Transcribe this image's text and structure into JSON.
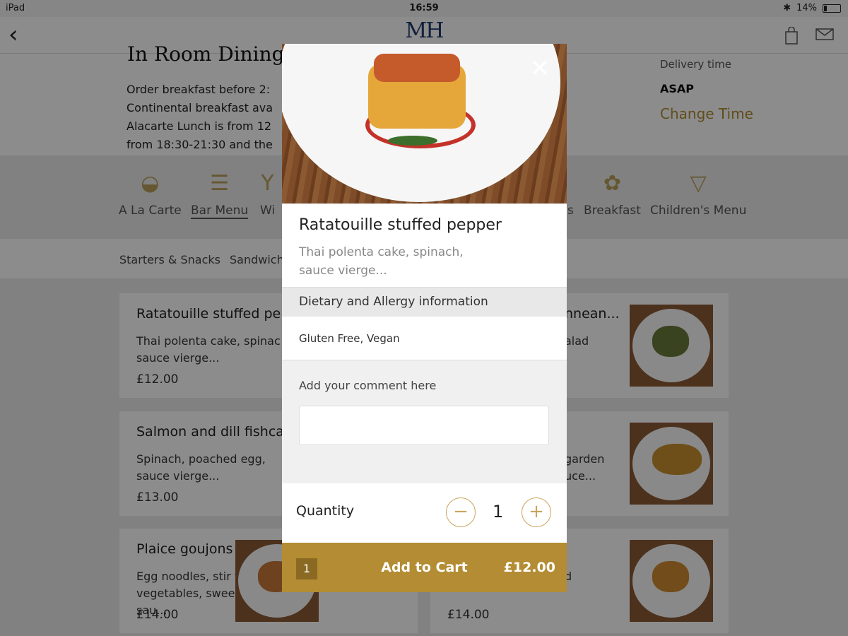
{
  "status_bar": {
    "device": "iPad",
    "time": "16:59",
    "battery": "14%"
  },
  "nav": {
    "logo": "MH"
  },
  "header": {
    "title": "In Room Dining",
    "intro": "Order breakfast before 2:\nContinental breakfast ava\nAlacarte Lunch is from 12\nfrom 18:30-21:30 and the",
    "delivery_label": "Delivery time",
    "delivery_value": "ASAP",
    "change_time": "Change Time"
  },
  "categories": [
    "A La Carte",
    "Bar Menu",
    "Wi",
    "s",
    "Breakfast",
    "Children's Menu"
  ],
  "subcategories": [
    "Starters & Snacks",
    "Sandwich"
  ],
  "menu_items": [
    {
      "name": "Ratatouille stuffed pep",
      "desc": "Thai polenta cake, spinac\nsauce vierge...",
      "price": "£12.00"
    },
    {
      "name": "Salmon and dill fishca",
      "desc": "Spinach, poached egg,\nsauce vierge...",
      "price": "£13.00"
    },
    {
      "name": "Plaice goujons",
      "desc": "Egg noodles, stir fry\nvegetables, sweet chilli sau...",
      "price": "£14.00"
    },
    {
      "name": "nnean...",
      "desc": "alad",
      "price": ""
    },
    {
      "name": "",
      "desc": "garden\nuce...",
      "price": ""
    },
    {
      "name": "",
      "desc": "d",
      "price": "£14.00"
    }
  ],
  "modal": {
    "close_icon": "close-icon",
    "dish_name": "Ratatouille stuffed pepper",
    "dish_desc": "Thai polenta cake, spinach,\nsauce vierge...",
    "dietary_heading": "Dietary and Allergy information",
    "dietary_value": "Gluten Free, Vegan",
    "comment_label": "Add your comment here",
    "comment_value": "",
    "quantity_label": "Quantity",
    "quantity": "1",
    "minus": "−",
    "plus": "+",
    "cart_count": "1",
    "cart_label": "Add to Cart",
    "cart_price": "£12.00"
  },
  "colors": {
    "accent": "#b38c33",
    "overlay": "rgba(0,0,0,0.45)"
  }
}
